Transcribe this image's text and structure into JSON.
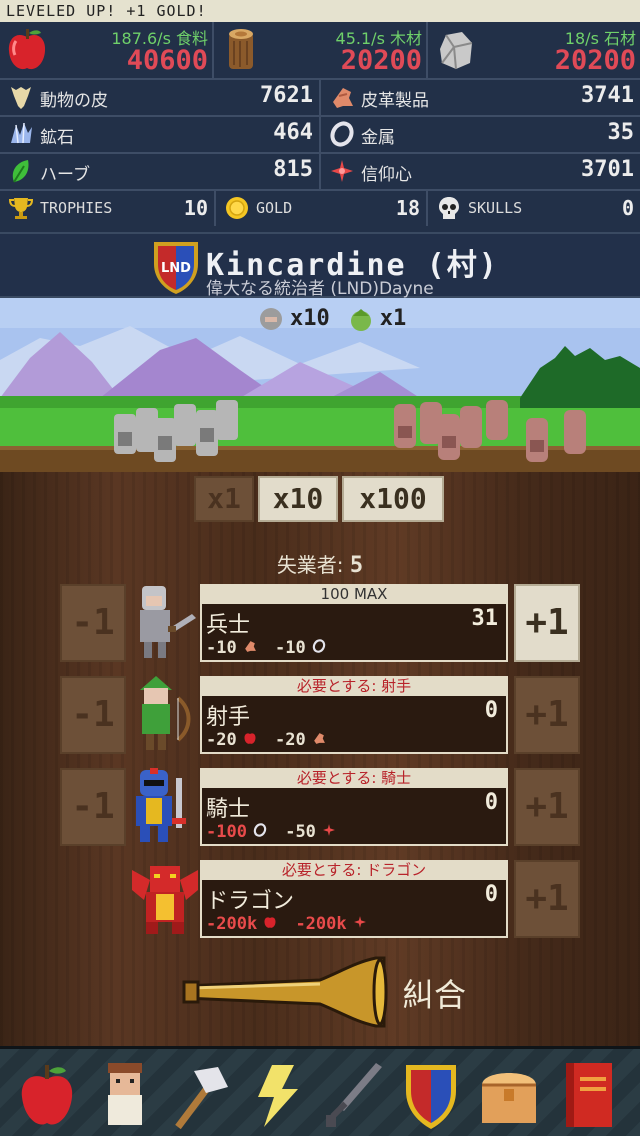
{
  "banner": "LEVELED UP! +1 GOLD!",
  "resources_top": [
    {
      "icon": "apple-icon",
      "rate": "187.6/s 食料",
      "value": "40600"
    },
    {
      "icon": "wood-log-icon",
      "rate": "45.1/s 木材",
      "value": "20200"
    },
    {
      "icon": "stone-icon",
      "rate": "18/s 石材",
      "value": "20200"
    }
  ],
  "resources": {
    "hide": {
      "icon": "animal-hide-icon",
      "label": "動物の皮",
      "value": "7621"
    },
    "leather": {
      "icon": "leather-icon",
      "label": "皮革製品",
      "value": "3741"
    },
    "ore": {
      "icon": "ore-crystal-icon",
      "label": "鉱石",
      "value": "464"
    },
    "metal": {
      "icon": "metal-ring-icon",
      "label": "金属",
      "value": "35"
    },
    "herb": {
      "icon": "herb-leaf-icon",
      "label": "ハーブ",
      "value": "815"
    },
    "faith": {
      "icon": "faith-cross-icon",
      "label": "信仰心",
      "value": "3701"
    },
    "trophies": {
      "icon": "trophy-icon",
      "label": "TROPHIES",
      "value": "10"
    },
    "gold": {
      "icon": "gold-coin-icon",
      "label": "GOLD",
      "value": "18"
    },
    "skulls": {
      "icon": "skull-icon",
      "label": "SKULLS",
      "value": "0"
    }
  },
  "village": {
    "badge": "LND",
    "name": "Kincardine (村)",
    "subtitle": "偉大なる統治者 (LND)Dayne"
  },
  "battle": {
    "enemy_count": "x10",
    "orc_count": "x1"
  },
  "multipliers": [
    "x1",
    "x10",
    "x100"
  ],
  "unemployed": {
    "label": "失業者:",
    "value": "5"
  },
  "units": [
    {
      "header": "100 MAX",
      "name": "兵士",
      "count": "31",
      "costs": [
        "-10",
        "-10"
      ],
      "cost_icons": [
        "leather-icon",
        "metal-ring-icon"
      ],
      "minus": "-1",
      "plus": "+1"
    },
    {
      "header": "必要とする: 射手",
      "name": "射手",
      "count": "0",
      "costs": [
        "-20",
        "-20"
      ],
      "cost_icons": [
        "apple-icon",
        "leather-icon"
      ],
      "minus": "-1",
      "plus": "+1"
    },
    {
      "header": "必要とする: 騎士",
      "name": "騎士",
      "count": "0",
      "costs": [
        "-100",
        "-50"
      ],
      "cost_icons": [
        "metal-ring-icon",
        "faith-cross-icon"
      ],
      "minus": "-1",
      "plus": "+1"
    },
    {
      "header": "必要とする: ドラゴン",
      "name": "ドラゴン",
      "count": "0",
      "costs": [
        "-200k",
        "-200k"
      ],
      "cost_icons": [
        "apple-icon",
        "faith-cross-icon"
      ],
      "plus": "+1"
    }
  ],
  "rally": "糾合",
  "nav": [
    "apple-icon",
    "villager-icon",
    "hammer-icon",
    "lightning-icon",
    "sword-icon",
    "shield-icon",
    "chest-icon",
    "book-icon"
  ],
  "colors": {
    "accent_red": "#e04a57",
    "rate_green": "#6fd06a",
    "panel_bg": "#223048",
    "required_red": "#b8232a"
  }
}
